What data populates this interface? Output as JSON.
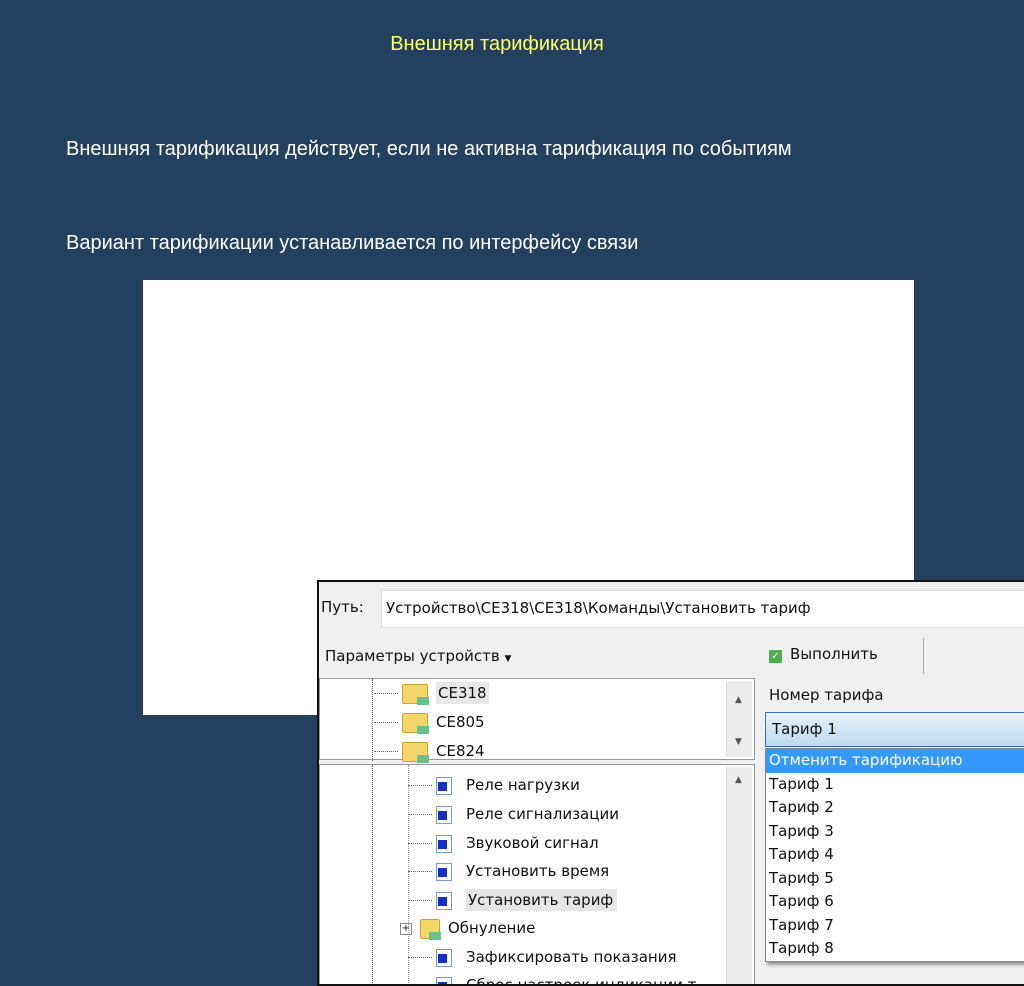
{
  "slide": {
    "title": "Внешняя тарификация",
    "paragraph1": "Внешняя тарификация действует, если не активна тарификация по событиям",
    "paragraph2": "Вариант тарификации устанавливается по интерфейсу связи"
  },
  "app": {
    "path_label": "Путь:",
    "path_value": "Устройство\\CE318\\CE318\\Команды\\Установить тариф",
    "params_menu": "Параметры устройств",
    "execute_button": "Выполнить",
    "devices": [
      "CE318",
      "CE805",
      "CE824"
    ],
    "commands": [
      "Реле нагрузки",
      "Реле сигнализации",
      "Звуковой сигнал",
      "Установить время",
      "Установить тариф",
      "Обнуление",
      "Зафиксировать показания",
      "Сброс настроек индикации т"
    ],
    "selected_command": "Установить тариф",
    "field_label": "Номер тарифа",
    "combo_value": "Тариф 1",
    "options": [
      "Отменить тарификацию",
      "Тариф 1",
      "Тариф 2",
      "Тариф 3",
      "Тариф 4",
      "Тариф 5",
      "Тариф 6",
      "Тариф 7",
      "Тариф 8"
    ],
    "highlighted_option": "Отменить тарификацию"
  }
}
